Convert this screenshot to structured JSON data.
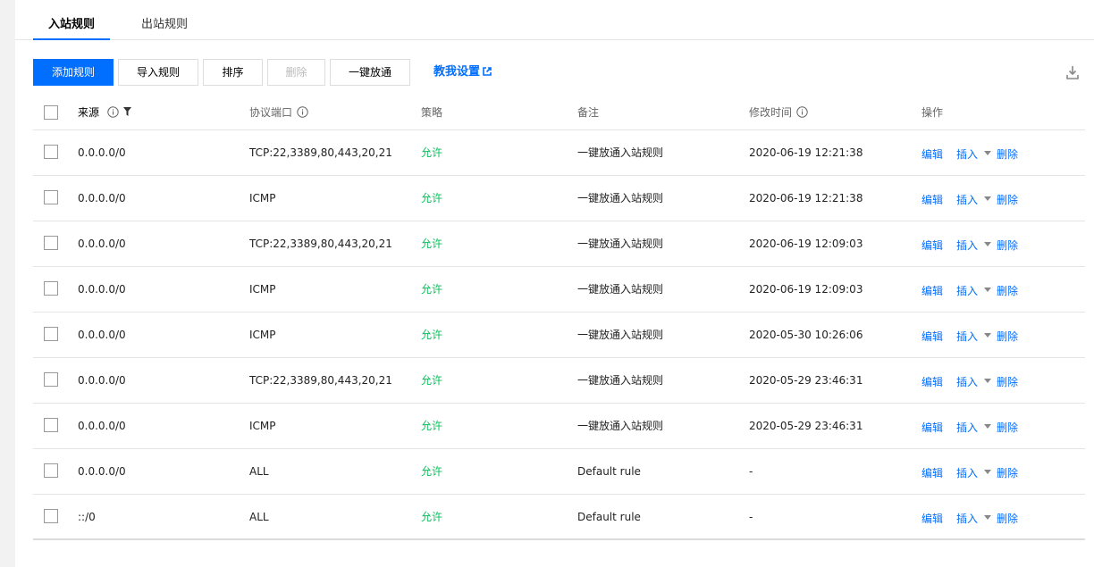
{
  "tabs": {
    "inbound": "入站规则",
    "outbound": "出站规则"
  },
  "toolbar": {
    "add_rule": "添加规则",
    "import_rules": "导入规则",
    "sort": "排序",
    "delete": "删除",
    "one_click_open": "一键放通",
    "teach_me": "教我设置"
  },
  "table": {
    "headers": {
      "source": "来源",
      "protocol_port": "协议端口",
      "policy": "策略",
      "remark": "备注",
      "modified_time": "修改时间",
      "actions": "操作"
    },
    "action_labels": {
      "edit": "编辑",
      "insert": "插入",
      "delete": "删除"
    },
    "rows": [
      {
        "source": "0.0.0.0/0",
        "port": "TCP:22,3389,80,443,20,21",
        "policy": "允许",
        "remark": "一键放通入站规则",
        "time": "2020-06-19 12:21:38"
      },
      {
        "source": "0.0.0.0/0",
        "port": "ICMP",
        "policy": "允许",
        "remark": "一键放通入站规则",
        "time": "2020-06-19 12:21:38"
      },
      {
        "source": "0.0.0.0/0",
        "port": "TCP:22,3389,80,443,20,21",
        "policy": "允许",
        "remark": "一键放通入站规则",
        "time": "2020-06-19 12:09:03"
      },
      {
        "source": "0.0.0.0/0",
        "port": "ICMP",
        "policy": "允许",
        "remark": "一键放通入站规则",
        "time": "2020-06-19 12:09:03"
      },
      {
        "source": "0.0.0.0/0",
        "port": "ICMP",
        "policy": "允许",
        "remark": "一键放通入站规则",
        "time": "2020-05-30 10:26:06"
      },
      {
        "source": "0.0.0.0/0",
        "port": "TCP:22,3389,80,443,20,21",
        "policy": "允许",
        "remark": "一键放通入站规则",
        "time": "2020-05-29 23:46:31"
      },
      {
        "source": "0.0.0.0/0",
        "port": "ICMP",
        "policy": "允许",
        "remark": "一键放通入站规则",
        "time": "2020-05-29 23:46:31"
      },
      {
        "source": "0.0.0.0/0",
        "port": "ALL",
        "policy": "允许",
        "remark": "Default rule",
        "time": "-"
      },
      {
        "source": "::/0",
        "port": "ALL",
        "policy": "允许",
        "remark": "Default rule",
        "time": "-"
      }
    ]
  },
  "colors": {
    "primary": "#006eff",
    "allow": "#0abf5b"
  }
}
